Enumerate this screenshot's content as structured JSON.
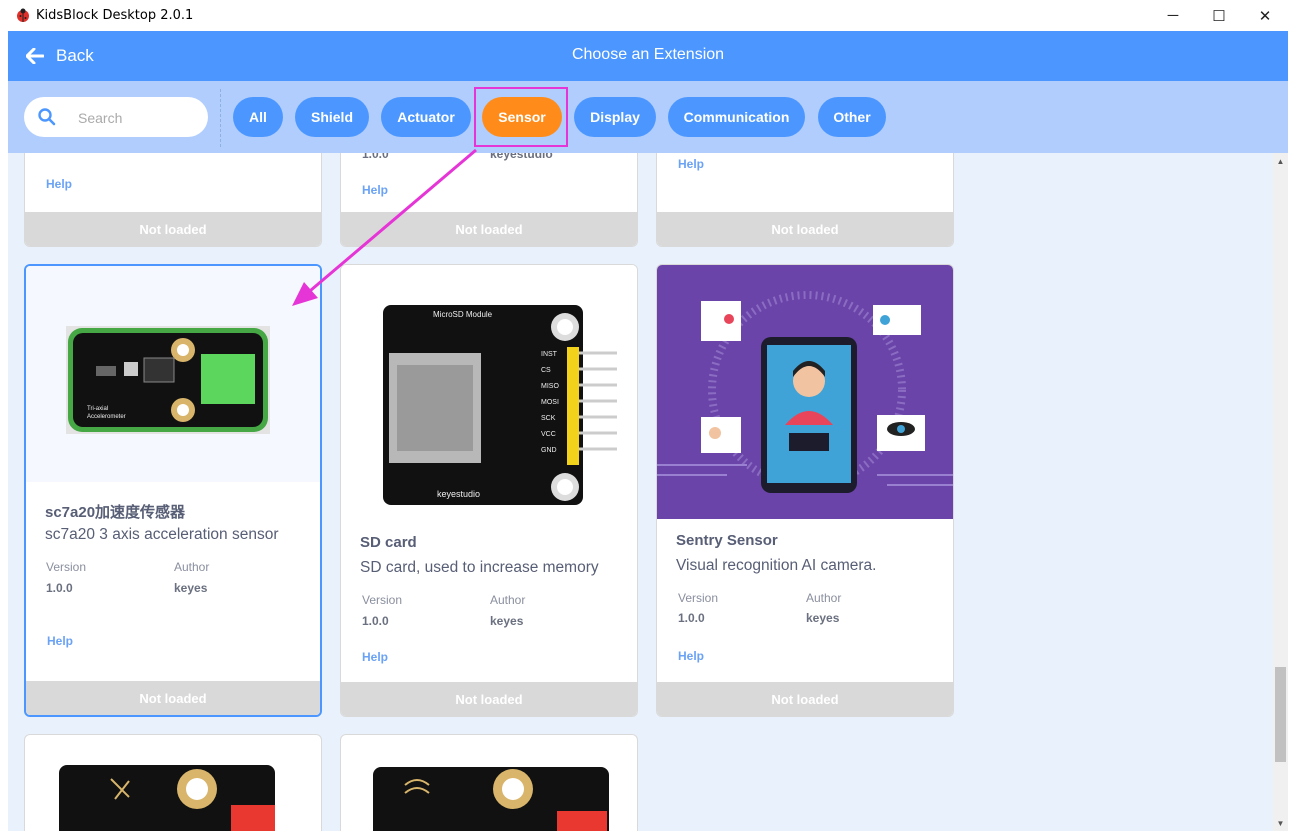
{
  "window": {
    "title": "KidsBlock Desktop 2.0.1",
    "controls": [
      "─",
      "☐",
      "✕"
    ]
  },
  "header": {
    "back_label": "Back",
    "title": "Choose an Extension"
  },
  "search": {
    "placeholder": "Search"
  },
  "filters": [
    "All",
    "Shield",
    "Actuator",
    "Sensor",
    "Display",
    "Communication",
    "Other"
  ],
  "active_filter": "Sensor",
  "partial_cards": [
    {
      "help": "Help",
      "status": "Not loaded"
    },
    {
      "version_value": "1.0.0",
      "author_value": "keyestudio",
      "help": "Help",
      "status": "Not loaded"
    },
    {
      "help": "Help",
      "status": "Not loaded"
    }
  ],
  "cards": [
    {
      "name": "sc7a20加速度传感器",
      "description": "sc7a20 3 axis acceleration sensor",
      "version_label": "Version",
      "version_value": "1.0.0",
      "author_label": "Author",
      "author_value": "keyes",
      "help": "Help",
      "status": "Not loaded",
      "image_text": [
        "Tri-axial",
        "Accelerometer"
      ]
    },
    {
      "name": "SD card",
      "description": "SD card, used to increase memory",
      "version_label": "Version",
      "version_value": "1.0.0",
      "author_label": "Author",
      "author_value": "keyes",
      "help": "Help",
      "status": "Not loaded",
      "image_text": {
        "module": "MicroSD Module",
        "brand": "keyestudio",
        "pins": [
          "INST",
          "CS",
          "MISO",
          "MOSI",
          "SCK",
          "VCC",
          "GND"
        ]
      }
    },
    {
      "name": "Sentry Sensor",
      "description": "Visual recognition AI camera.",
      "version_label": "Version",
      "version_value": "1.0.0",
      "author_label": "Author",
      "author_value": "keyes",
      "help": "Help",
      "status": "Not loaded"
    }
  ],
  "colors": {
    "header": "#4c97ff",
    "filterbar": "#b0cdfd",
    "active": "#ff8c1a",
    "highlight": "#e635d6",
    "content_bg": "#e9f1fc"
  }
}
